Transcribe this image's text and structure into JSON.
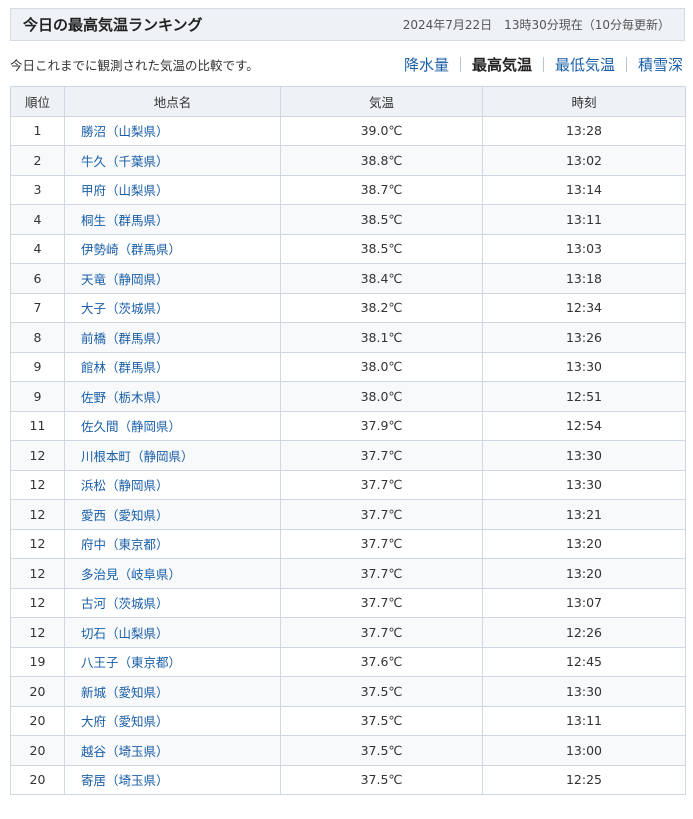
{
  "header": {
    "title": "今日の最高気温ランキング",
    "timestamp": "2024年7月22日　13時30分現在（10分毎更新）"
  },
  "description": "今日これまでに観測された気温の比較です。",
  "tabs": [
    {
      "label": "降水量",
      "active": false
    },
    {
      "label": "最高気温",
      "active": true
    },
    {
      "label": "最低気温",
      "active": false
    },
    {
      "label": "積雪深",
      "active": false
    }
  ],
  "table": {
    "headers": [
      "順位",
      "地点名",
      "気温",
      "時刻"
    ],
    "rows": [
      {
        "rank": "1",
        "place": "勝沼（山梨県）",
        "temp": "39.0℃",
        "time": "13:28"
      },
      {
        "rank": "2",
        "place": "牛久（千葉県）",
        "temp": "38.8℃",
        "time": "13:02"
      },
      {
        "rank": "3",
        "place": "甲府（山梨県）",
        "temp": "38.7℃",
        "time": "13:14"
      },
      {
        "rank": "4",
        "place": "桐生（群馬県）",
        "temp": "38.5℃",
        "time": "13:11"
      },
      {
        "rank": "4",
        "place": "伊勢崎（群馬県）",
        "temp": "38.5℃",
        "time": "13:03"
      },
      {
        "rank": "6",
        "place": "天竜（静岡県）",
        "temp": "38.4℃",
        "time": "13:18"
      },
      {
        "rank": "7",
        "place": "大子（茨城県）",
        "temp": "38.2℃",
        "time": "12:34"
      },
      {
        "rank": "8",
        "place": "前橋（群馬県）",
        "temp": "38.1℃",
        "time": "13:26"
      },
      {
        "rank": "9",
        "place": "館林（群馬県）",
        "temp": "38.0℃",
        "time": "13:30"
      },
      {
        "rank": "9",
        "place": "佐野（栃木県）",
        "temp": "38.0℃",
        "time": "12:51"
      },
      {
        "rank": "11",
        "place": "佐久間（静岡県）",
        "temp": "37.9℃",
        "time": "12:54"
      },
      {
        "rank": "12",
        "place": "川根本町（静岡県）",
        "temp": "37.7℃",
        "time": "13:30"
      },
      {
        "rank": "12",
        "place": "浜松（静岡県）",
        "temp": "37.7℃",
        "time": "13:30"
      },
      {
        "rank": "12",
        "place": "愛西（愛知県）",
        "temp": "37.7℃",
        "time": "13:21"
      },
      {
        "rank": "12",
        "place": "府中（東京都）",
        "temp": "37.7℃",
        "time": "13:20"
      },
      {
        "rank": "12",
        "place": "多治見（岐阜県）",
        "temp": "37.7℃",
        "time": "13:20"
      },
      {
        "rank": "12",
        "place": "古河（茨城県）",
        "temp": "37.7℃",
        "time": "13:07"
      },
      {
        "rank": "12",
        "place": "切石（山梨県）",
        "temp": "37.7℃",
        "time": "12:26"
      },
      {
        "rank": "19",
        "place": "八王子（東京都）",
        "temp": "37.6℃",
        "time": "12:45"
      },
      {
        "rank": "20",
        "place": "新城（愛知県）",
        "temp": "37.5℃",
        "time": "13:30"
      },
      {
        "rank": "20",
        "place": "大府（愛知県）",
        "temp": "37.5℃",
        "time": "13:11"
      },
      {
        "rank": "20",
        "place": "越谷（埼玉県）",
        "temp": "37.5℃",
        "time": "13:00"
      },
      {
        "rank": "20",
        "place": "寄居（埼玉県）",
        "temp": "37.5℃",
        "time": "12:25"
      }
    ]
  },
  "colors": {
    "link": "#1a5fa8",
    "header_bg": "#eef1f5",
    "border": "#cfd8e2"
  }
}
